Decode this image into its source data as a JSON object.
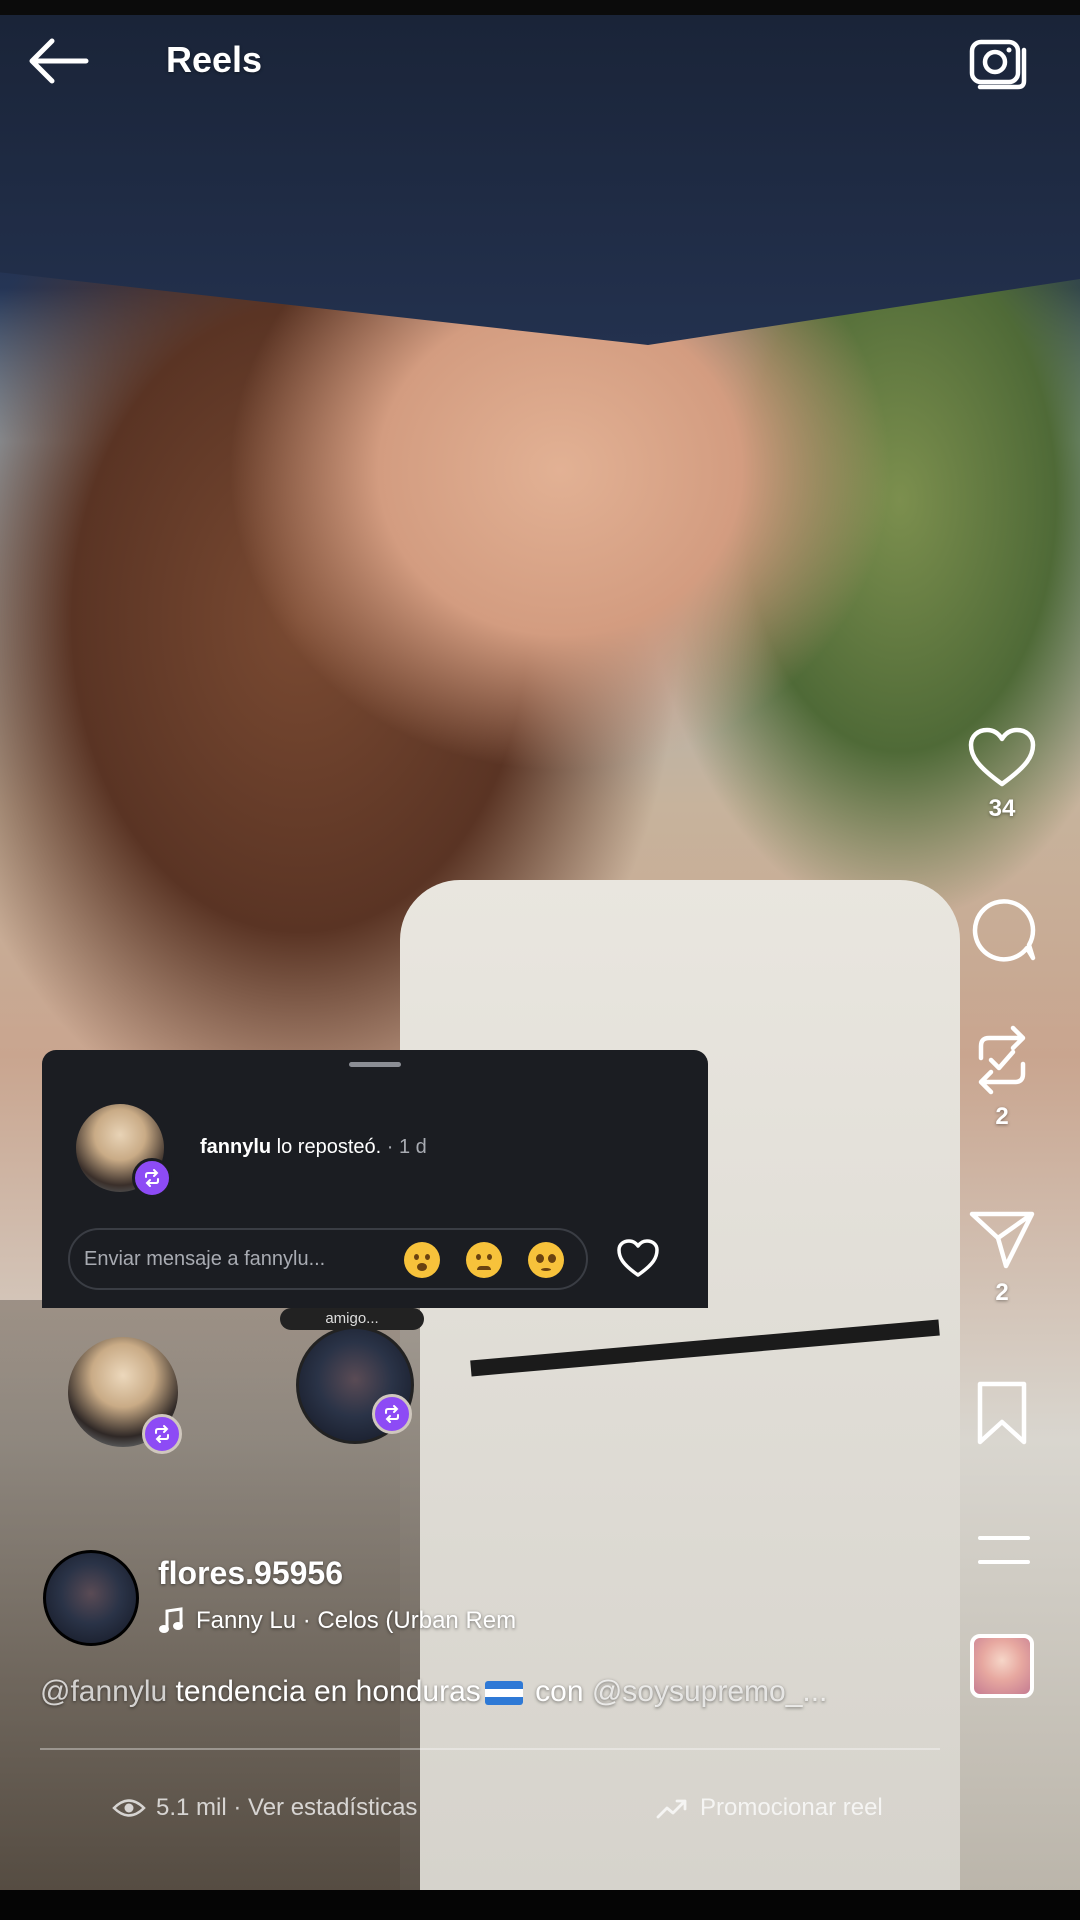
{
  "header": {
    "title": "Reels"
  },
  "actions": {
    "likes": "34",
    "reposts": "2",
    "shares": "2"
  },
  "repost_sheet": {
    "username": "fannylu",
    "text": " lo reposteó.",
    "time": " · 1 d",
    "message_placeholder": "Enviar mensaje a fannylu..."
  },
  "story_label": "amigo...",
  "post": {
    "author": "flores.95956",
    "audio": "Fanny Lu · Celos (Urban Rem",
    "caption_mention": "@fannylu",
    "caption_text": " tendencia en honduras",
    "caption_con": " con ",
    "caption_mention2": "@soysupremo_...",
    "views": "5.1 mil · Ver estadísticas",
    "promote": "Promocionar reel"
  },
  "colors": {
    "repost_badge": "#8d4bf5",
    "sheet_bg": "#1b1d22"
  },
  "icons": [
    "back-arrow-icon",
    "camera-icon",
    "heart-icon",
    "comment-icon",
    "repost-icon",
    "send-icon",
    "bookmark-icon",
    "more-menu-icon",
    "music-note-icon",
    "eye-icon",
    "chart-icon"
  ]
}
